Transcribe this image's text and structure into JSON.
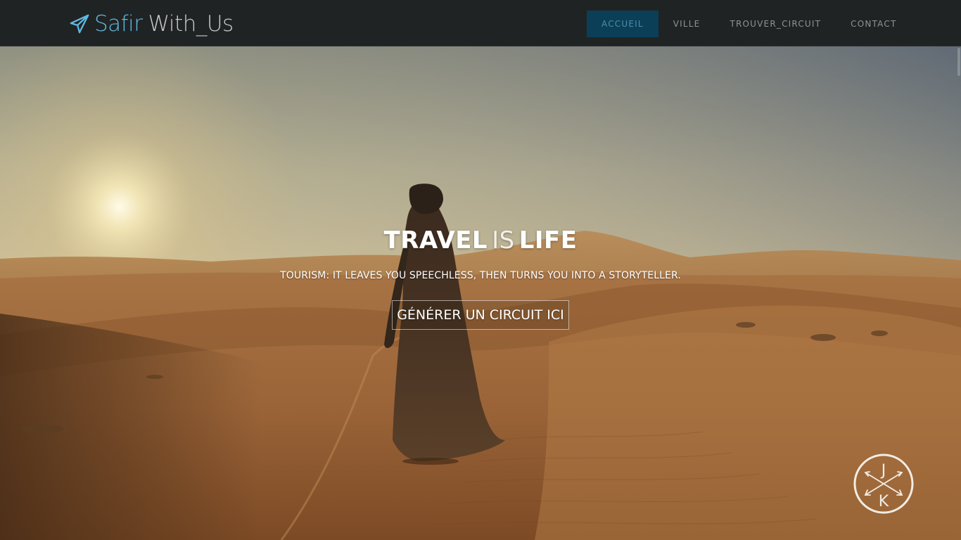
{
  "brand": {
    "part1": "Safir",
    "part2": "With_Us",
    "icon": "paper-plane-icon"
  },
  "nav": {
    "items": [
      {
        "label": "ACCUEIL",
        "active": true
      },
      {
        "label": "VILLE",
        "active": false
      },
      {
        "label": "TROUVER_CIRCUIT",
        "active": false
      },
      {
        "label": "CONTACT",
        "active": false
      }
    ]
  },
  "hero": {
    "title_word1": "TRAVEL",
    "title_word2": "IS",
    "title_word3": "LIFE",
    "subtitle": "TOURISM: IT LEAVES YOU SPEECHLESS, THEN TURNS YOU INTO A STORYTELLER.",
    "button_label": "GÉNÉRER UN CIRCUIT ICI"
  },
  "watermark": {
    "letter_top": "J",
    "letter_bottom": "K"
  },
  "colors": {
    "navbar_bg": "#202324",
    "brand_accent": "#5fb9e1",
    "nav_active_bg": "#0b3f57",
    "nav_active_text": "#4c8eac"
  }
}
